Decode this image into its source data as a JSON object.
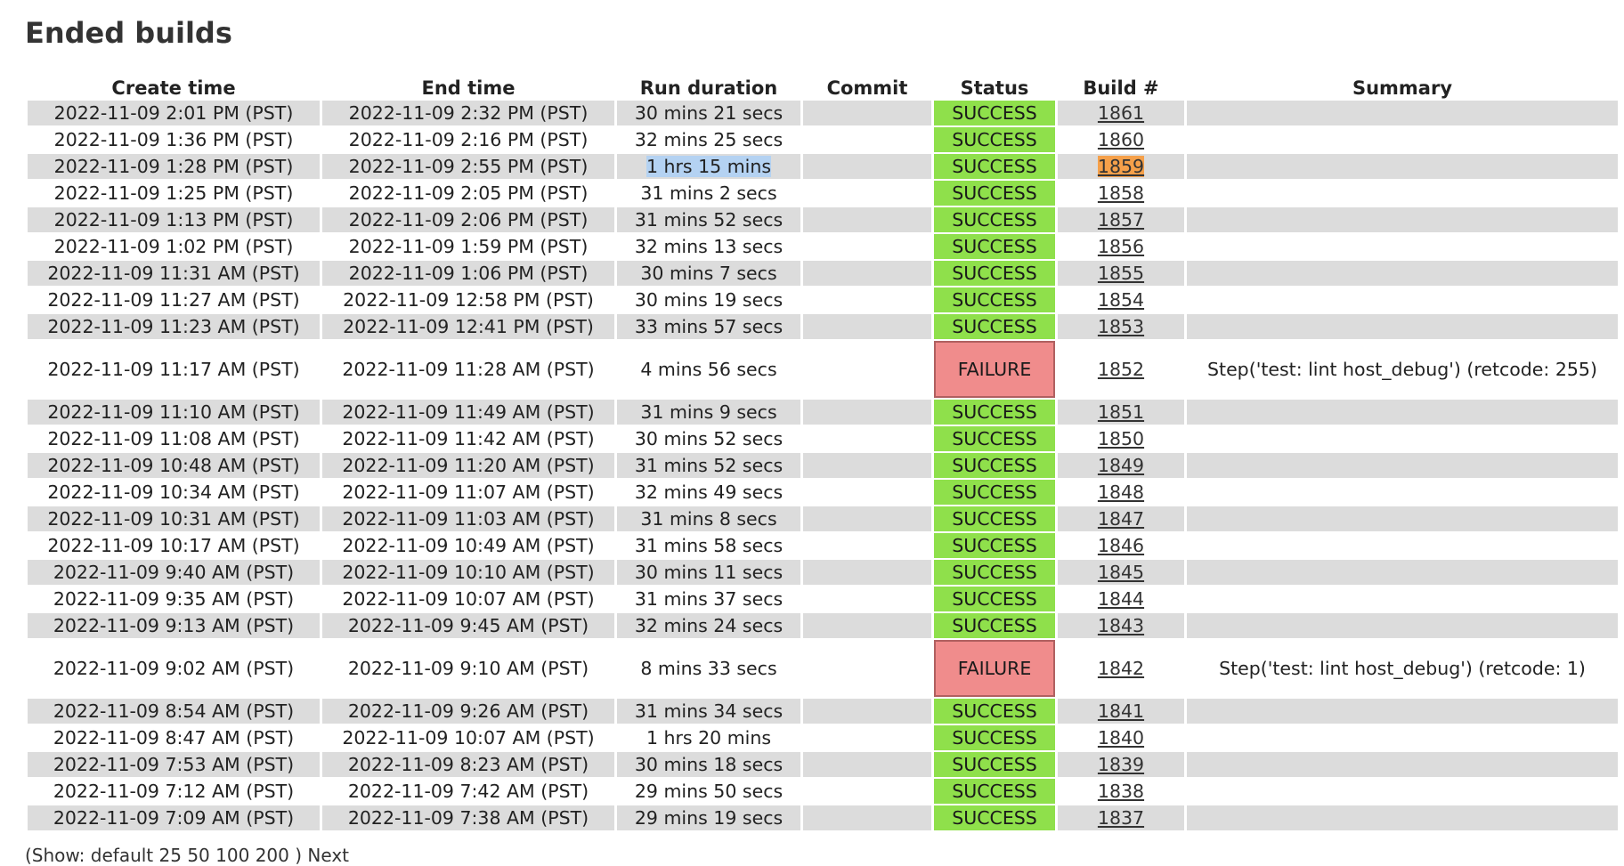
{
  "page": {
    "title": "Ended builds"
  },
  "table": {
    "headers": [
      "Create time",
      "End time",
      "Run duration",
      "Commit",
      "Status",
      "Build #",
      "Summary"
    ],
    "rows": [
      {
        "create": "2022-11-09 2:01 PM (PST)",
        "end": "2022-11-09 2:32 PM (PST)",
        "duration": "30 mins 21 secs",
        "commit": "",
        "status": "SUCCESS",
        "build": "1861",
        "summary": ""
      },
      {
        "create": "2022-11-09 1:36 PM (PST)",
        "end": "2022-11-09 2:16 PM (PST)",
        "duration": "32 mins 25 secs",
        "commit": "",
        "status": "SUCCESS",
        "build": "1860",
        "summary": ""
      },
      {
        "create": "2022-11-09 1:28 PM (PST)",
        "end": "2022-11-09 2:55 PM (PST)",
        "duration": "1 hrs 15 mins",
        "commit": "",
        "status": "SUCCESS",
        "build": "1859",
        "summary": "",
        "selected": true,
        "highlight": true
      },
      {
        "create": "2022-11-09 1:25 PM (PST)",
        "end": "2022-11-09 2:05 PM (PST)",
        "duration": "31 mins 2 secs",
        "commit": "",
        "status": "SUCCESS",
        "build": "1858",
        "summary": ""
      },
      {
        "create": "2022-11-09 1:13 PM (PST)",
        "end": "2022-11-09 2:06 PM (PST)",
        "duration": "31 mins 52 secs",
        "commit": "",
        "status": "SUCCESS",
        "build": "1857",
        "summary": ""
      },
      {
        "create": "2022-11-09 1:02 PM (PST)",
        "end": "2022-11-09 1:59 PM (PST)",
        "duration": "32 mins 13 secs",
        "commit": "",
        "status": "SUCCESS",
        "build": "1856",
        "summary": ""
      },
      {
        "create": "2022-11-09 11:31 AM (PST)",
        "end": "2022-11-09 1:06 PM (PST)",
        "duration": "30 mins 7 secs",
        "commit": "",
        "status": "SUCCESS",
        "build": "1855",
        "summary": ""
      },
      {
        "create": "2022-11-09 11:27 AM (PST)",
        "end": "2022-11-09 12:58 PM (PST)",
        "duration": "30 mins 19 secs",
        "commit": "",
        "status": "SUCCESS",
        "build": "1854",
        "summary": ""
      },
      {
        "create": "2022-11-09 11:23 AM (PST)",
        "end": "2022-11-09 12:41 PM (PST)",
        "duration": "33 mins 57 secs",
        "commit": "",
        "status": "SUCCESS",
        "build": "1853",
        "summary": ""
      },
      {
        "create": "2022-11-09 11:17 AM (PST)",
        "end": "2022-11-09 11:28 AM (PST)",
        "duration": "4 mins 56 secs",
        "commit": "",
        "status": "FAILURE",
        "build": "1852",
        "summary": "Step('test: lint host_debug') (retcode: 255)"
      },
      {
        "create": "2022-11-09 11:10 AM (PST)",
        "end": "2022-11-09 11:49 AM (PST)",
        "duration": "31 mins 9 secs",
        "commit": "",
        "status": "SUCCESS",
        "build": "1851",
        "summary": ""
      },
      {
        "create": "2022-11-09 11:08 AM (PST)",
        "end": "2022-11-09 11:42 AM (PST)",
        "duration": "30 mins 52 secs",
        "commit": "",
        "status": "SUCCESS",
        "build": "1850",
        "summary": ""
      },
      {
        "create": "2022-11-09 10:48 AM (PST)",
        "end": "2022-11-09 11:20 AM (PST)",
        "duration": "31 mins 52 secs",
        "commit": "",
        "status": "SUCCESS",
        "build": "1849",
        "summary": ""
      },
      {
        "create": "2022-11-09 10:34 AM (PST)",
        "end": "2022-11-09 11:07 AM (PST)",
        "duration": "32 mins 49 secs",
        "commit": "",
        "status": "SUCCESS",
        "build": "1848",
        "summary": ""
      },
      {
        "create": "2022-11-09 10:31 AM (PST)",
        "end": "2022-11-09 11:03 AM (PST)",
        "duration": "31 mins 8 secs",
        "commit": "",
        "status": "SUCCESS",
        "build": "1847",
        "summary": ""
      },
      {
        "create": "2022-11-09 10:17 AM (PST)",
        "end": "2022-11-09 10:49 AM (PST)",
        "duration": "31 mins 58 secs",
        "commit": "",
        "status": "SUCCESS",
        "build": "1846",
        "summary": ""
      },
      {
        "create": "2022-11-09 9:40 AM (PST)",
        "end": "2022-11-09 10:10 AM (PST)",
        "duration": "30 mins 11 secs",
        "commit": "",
        "status": "SUCCESS",
        "build": "1845",
        "summary": ""
      },
      {
        "create": "2022-11-09 9:35 AM (PST)",
        "end": "2022-11-09 10:07 AM (PST)",
        "duration": "31 mins 37 secs",
        "commit": "",
        "status": "SUCCESS",
        "build": "1844",
        "summary": ""
      },
      {
        "create": "2022-11-09 9:13 AM (PST)",
        "end": "2022-11-09 9:45 AM (PST)",
        "duration": "32 mins 24 secs",
        "commit": "",
        "status": "SUCCESS",
        "build": "1843",
        "summary": ""
      },
      {
        "create": "2022-11-09 9:02 AM (PST)",
        "end": "2022-11-09 9:10 AM (PST)",
        "duration": "8 mins 33 secs",
        "commit": "",
        "status": "FAILURE",
        "build": "1842",
        "summary": "Step('test: lint host_debug') (retcode: 1)"
      },
      {
        "create": "2022-11-09 8:54 AM (PST)",
        "end": "2022-11-09 9:26 AM (PST)",
        "duration": "31 mins 34 secs",
        "commit": "",
        "status": "SUCCESS",
        "build": "1841",
        "summary": ""
      },
      {
        "create": "2022-11-09 8:47 AM (PST)",
        "end": "2022-11-09 10:07 AM (PST)",
        "duration": "1 hrs 20 mins",
        "commit": "",
        "status": "SUCCESS",
        "build": "1840",
        "summary": ""
      },
      {
        "create": "2022-11-09 7:53 AM (PST)",
        "end": "2022-11-09 8:23 AM (PST)",
        "duration": "30 mins 18 secs",
        "commit": "",
        "status": "SUCCESS",
        "build": "1839",
        "summary": ""
      },
      {
        "create": "2022-11-09 7:12 AM (PST)",
        "end": "2022-11-09 7:42 AM (PST)",
        "duration": "29 mins 50 secs",
        "commit": "",
        "status": "SUCCESS",
        "build": "1838",
        "summary": ""
      },
      {
        "create": "2022-11-09 7:09 AM (PST)",
        "end": "2022-11-09 7:38 AM (PST)",
        "duration": "29 mins 19 secs",
        "commit": "",
        "status": "SUCCESS",
        "build": "1837",
        "summary": ""
      }
    ]
  },
  "pagination": {
    "show_label": "(Show:",
    "options": [
      "default",
      "25",
      "50",
      "100",
      "200"
    ],
    "close": ")",
    "next_label": "Next"
  },
  "colors": {
    "success": "#8fe04b",
    "failure": "#f08c8c",
    "row_stripe": "#dcdcdc",
    "link_highlight": "#f5a04a",
    "text_selection": "#b4d2f2"
  }
}
